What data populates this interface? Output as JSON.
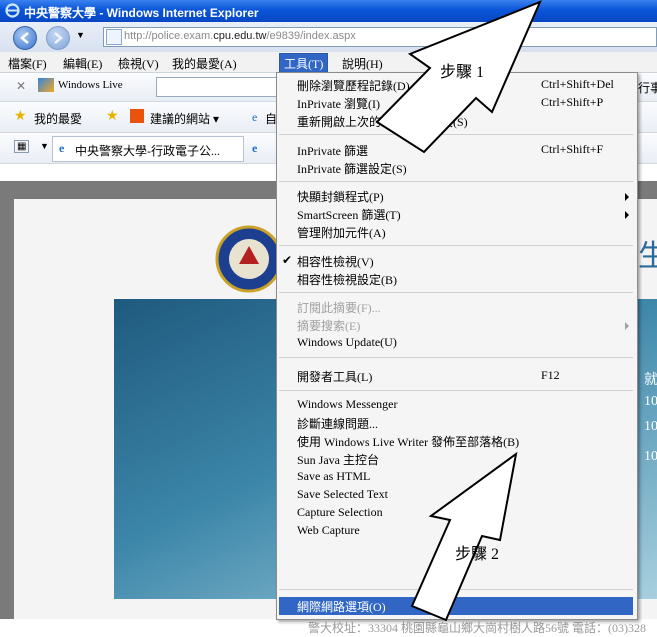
{
  "window": {
    "title": "中央警察大學 - Windows Internet Explorer",
    "url_prefix": "http://police.exam.",
    "url_domain": "cpu.edu.tw",
    "url_path": "/e9839/index.aspx"
  },
  "menubar": {
    "items": [
      "檔案(F)",
      "編輯(E)",
      "檢視(V)",
      "我的最愛(A)",
      "工具(T)",
      "說明(H)"
    ]
  },
  "toolbar": {
    "live_label": "Windows Live",
    "favorites_label": "我的最愛",
    "suggested_label": "建議的網站 ▾",
    "tab_label": "中央警察大學-行政電子公...",
    "right_clip": "行事",
    "ie_clip": "自"
  },
  "tools_menu": {
    "items": [
      {
        "label": "刪除瀏覽歷程記錄(D)...",
        "shortcut": "Ctrl+Shift+Del"
      },
      {
        "label": "InPrivate 瀏覽(I)",
        "shortcut": "Ctrl+Shift+P"
      },
      {
        "label": "重新開啟上次的瀏覽工作階段(S)",
        "shortcut": ""
      },
      {
        "label": "InPrivate 篩選",
        "shortcut": "Ctrl+Shift+F"
      },
      {
        "label": "InPrivate 篩選設定(S)",
        "shortcut": ""
      },
      {
        "label": "快顯封鎖程式(P)",
        "shortcut": ""
      },
      {
        "label": "SmartScreen 篩選(T)",
        "shortcut": ""
      },
      {
        "label": "管理附加元件(A)",
        "shortcut": ""
      },
      {
        "label": "相容性檢視(V)",
        "shortcut": ""
      },
      {
        "label": "相容性檢視設定(B)",
        "shortcut": ""
      },
      {
        "label": "訂閱此摘要(F)...",
        "shortcut": ""
      },
      {
        "label": "摘要搜索(E)",
        "shortcut": ""
      },
      {
        "label": "Windows Update(U)",
        "shortcut": ""
      },
      {
        "label": "開發者工具(L)",
        "shortcut": "F12"
      },
      {
        "label": "Windows Messenger",
        "shortcut": ""
      },
      {
        "label": "診斷連線問題...",
        "shortcut": ""
      },
      {
        "label": "使用 Windows Live Writer 發佈至部落格(B)",
        "shortcut": ""
      },
      {
        "label": "Sun Java 主控台",
        "shortcut": ""
      },
      {
        "label": "Save as HTML",
        "shortcut": ""
      },
      {
        "label": "Save Selected Text",
        "shortcut": ""
      },
      {
        "label": "Capture Selection",
        "shortcut": ""
      },
      {
        "label": "Web Capture",
        "shortcut": ""
      },
      {
        "label": "網際網路選項(O)",
        "shortcut": ""
      }
    ]
  },
  "page": {
    "footer": "警大校址：33304 桃園縣龜山鄉大崗村樹人路56號 電話：(03)328",
    "side_glyph": "生",
    "side_text": [
      "就",
      "10",
      "10",
      "10"
    ]
  },
  "annotations": {
    "step1": "步驟 1",
    "step2": "步驟 2"
  },
  "colors": {
    "titlebar": "#0a55d8",
    "highlight": "#3166c5"
  }
}
